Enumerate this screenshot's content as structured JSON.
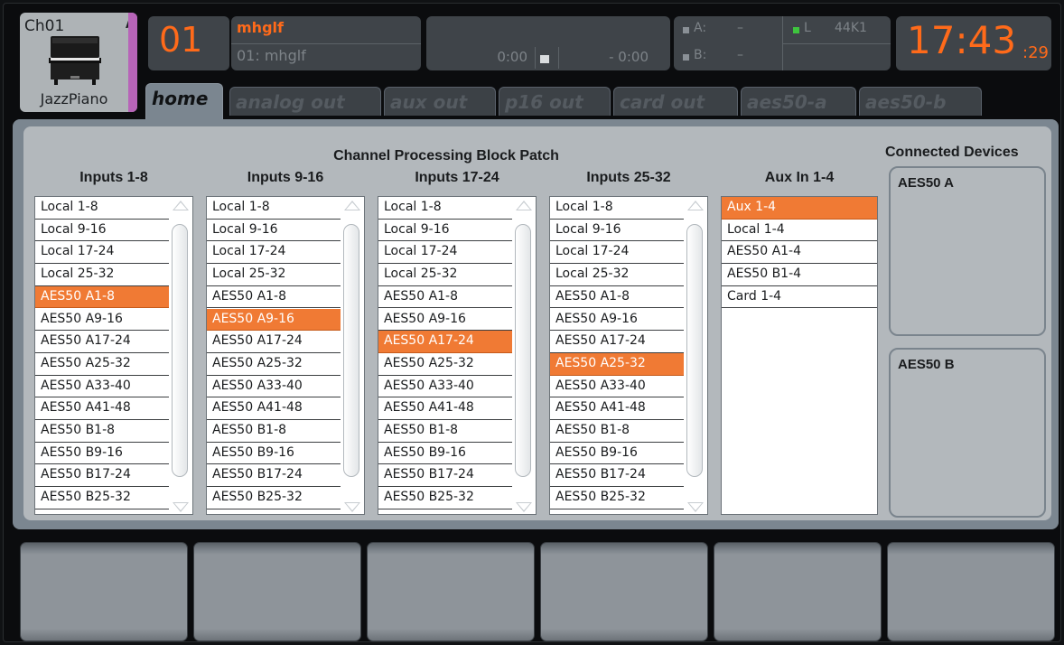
{
  "channel": {
    "name": "Ch01",
    "flag": "A",
    "label": "JazzPiano",
    "number": "01",
    "icon": "piano-icon",
    "strip_color": "#b764b8"
  },
  "scene": {
    "name": "mhglf",
    "current": "01: mhglf"
  },
  "transport": {
    "elapsed": "0:00",
    "remaining": "- 0:00"
  },
  "io": {
    "a_label": "A:",
    "a_value": "–",
    "b_label": "B:",
    "b_value": "–",
    "sync_label": "L",
    "sample_rate": "44K1",
    "sync_color": "#3ec43e"
  },
  "clock": {
    "time": "17:43",
    "seconds": ":29"
  },
  "tabs": [
    {
      "label": "home",
      "active": true
    },
    {
      "label": "analog out"
    },
    {
      "label": "aux out"
    },
    {
      "label": "p16 out"
    },
    {
      "label": "card out"
    },
    {
      "label": "aes50-a"
    },
    {
      "label": "aes50-b"
    }
  ],
  "panel": {
    "title": "Channel Processing Block Patch",
    "columns": [
      {
        "header": "Inputs 1-8",
        "selected": "AES50 A1-8",
        "items": [
          "Local 1-8",
          "Local 9-16",
          "Local 17-24",
          "Local 25-32",
          "AES50 A1-8",
          "AES50 A9-16",
          "AES50 A17-24",
          "AES50 A25-32",
          "AES50 A33-40",
          "AES50 A41-48",
          "AES50 B1-8",
          "AES50 B9-16",
          "AES50 B17-24",
          "AES50 B25-32"
        ]
      },
      {
        "header": "Inputs 9-16",
        "selected": "AES50 A9-16",
        "items": [
          "Local 1-8",
          "Local 9-16",
          "Local 17-24",
          "Local 25-32",
          "AES50 A1-8",
          "AES50 A9-16",
          "AES50 A17-24",
          "AES50 A25-32",
          "AES50 A33-40",
          "AES50 A41-48",
          "AES50 B1-8",
          "AES50 B9-16",
          "AES50 B17-24",
          "AES50 B25-32"
        ]
      },
      {
        "header": "Inputs 17-24",
        "selected": "AES50 A17-24",
        "items": [
          "Local 1-8",
          "Local 9-16",
          "Local 17-24",
          "Local 25-32",
          "AES50 A1-8",
          "AES50 A9-16",
          "AES50 A17-24",
          "AES50 A25-32",
          "AES50 A33-40",
          "AES50 A41-48",
          "AES50 B1-8",
          "AES50 B9-16",
          "AES50 B17-24",
          "AES50 B25-32"
        ]
      },
      {
        "header": "Inputs 25-32",
        "selected": "AES50 A25-32",
        "items": [
          "Local 1-8",
          "Local 9-16",
          "Local 17-24",
          "Local 25-32",
          "AES50 A1-8",
          "AES50 A9-16",
          "AES50 A17-24",
          "AES50 A25-32",
          "AES50 A33-40",
          "AES50 A41-48",
          "AES50 B1-8",
          "AES50 B9-16",
          "AES50 B17-24",
          "AES50 B25-32"
        ]
      },
      {
        "header": "Aux In 1-4",
        "selected": "Aux 1-4",
        "items": [
          "Aux 1-4",
          "Local 1-4",
          "AES50 A1-4",
          "AES50 B1-4",
          "Card 1-4"
        ]
      }
    ],
    "devices_title": "Connected Devices",
    "devices": [
      {
        "name": "AES50 A"
      },
      {
        "name": "AES50 B"
      }
    ]
  },
  "selection_color": "#f07a34",
  "accent": "#ff6a1a"
}
